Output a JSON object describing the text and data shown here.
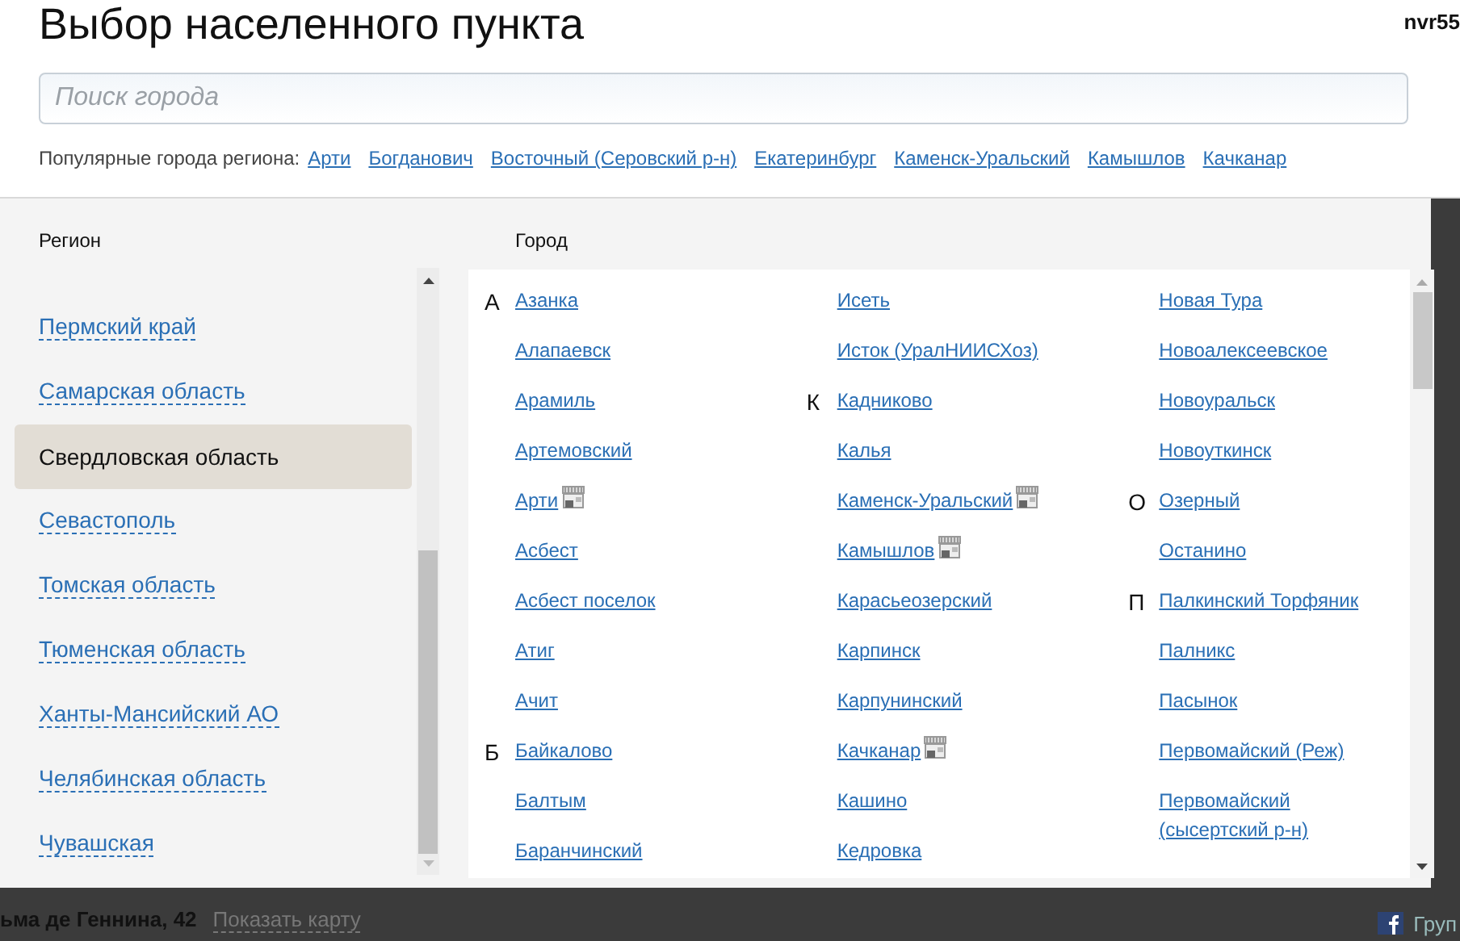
{
  "title": "Выбор населенного пункта",
  "user": "nvr55",
  "search": {
    "placeholder": "Поиск города"
  },
  "popular": {
    "label": "Популярные города региона:",
    "cities": [
      "Арти",
      "Богданович",
      "Восточный (Серовский р-н)",
      "Екатеринбург",
      "Каменск-Уральский",
      "Камышлов",
      "Качканар"
    ]
  },
  "regions": {
    "heading": "Регион",
    "items": [
      {
        "name": "Пермский край",
        "selected": false
      },
      {
        "name": "Самарская область",
        "selected": false
      },
      {
        "name": "Свердловская область",
        "selected": true
      },
      {
        "name": "Севастополь",
        "selected": false
      },
      {
        "name": "Томская область",
        "selected": false
      },
      {
        "name": "Тюменская область",
        "selected": false
      },
      {
        "name": "Ханты-Мансийский АО",
        "selected": false
      },
      {
        "name": "Челябинская область",
        "selected": false
      },
      {
        "name": "Чувашская",
        "selected": false
      }
    ]
  },
  "cities": {
    "heading": "Город",
    "columns": [
      [
        {
          "letter": "А",
          "name": "Азанка",
          "store": false
        },
        {
          "name": "Алапаевск",
          "store": false
        },
        {
          "name": "Арамиль",
          "store": false
        },
        {
          "name": "Артемовский",
          "store": false
        },
        {
          "name": "Арти",
          "store": true
        },
        {
          "name": "Асбест",
          "store": false
        },
        {
          "name": "Асбест поселок",
          "store": false
        },
        {
          "name": "Атиг",
          "store": false
        },
        {
          "name": "Ачит",
          "store": false
        },
        {
          "letter": "Б",
          "name": "Байкалово",
          "store": false
        },
        {
          "name": "Балтым",
          "store": false
        },
        {
          "name": "Баранчинский",
          "store": false
        }
      ],
      [
        {
          "name": "Исеть",
          "store": false
        },
        {
          "name": "Исток (УралНИИСХоз)",
          "store": false
        },
        {
          "letter": "К",
          "name": "Кадниково",
          "store": false
        },
        {
          "name": "Калья",
          "store": false
        },
        {
          "name": "Каменск-Уральский",
          "store": true
        },
        {
          "name": "Камышлов",
          "store": true
        },
        {
          "name": "Карасьеозерский",
          "store": false
        },
        {
          "name": "Карпинск",
          "store": false
        },
        {
          "name": "Карпунинский",
          "store": false
        },
        {
          "name": "Качканар",
          "store": true
        },
        {
          "name": "Кашино",
          "store": false
        },
        {
          "name": "Кедровка",
          "store": false
        }
      ],
      [
        {
          "name": "Новая Тура",
          "store": false
        },
        {
          "name": "Новоалексеевское",
          "store": false
        },
        {
          "name": "Новоуральск",
          "store": false
        },
        {
          "name": "Новоуткинск",
          "store": false
        },
        {
          "letter": "О",
          "name": "Озерный",
          "store": false
        },
        {
          "name": "Останино",
          "store": false
        },
        {
          "letter": "П",
          "name": "Палкинский Торфяник",
          "store": false
        },
        {
          "name": "Палникс",
          "store": false
        },
        {
          "name": "Пасынок",
          "store": false
        },
        {
          "name": "Первомайский (Реж)",
          "store": false
        },
        {
          "name": "Первомайский (сысертский р-н)",
          "store": false
        }
      ]
    ]
  },
  "footer": {
    "address": "ьма де Геннина, 42",
    "map_link": "Показать карту",
    "social": "Груп"
  }
}
